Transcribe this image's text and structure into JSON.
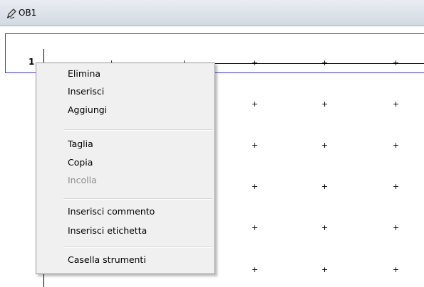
{
  "window": {
    "title": "OB1",
    "icon": "pencil-icon"
  },
  "network": {
    "number": "1"
  },
  "grid": {
    "marker": "+"
  },
  "menu": {
    "items": [
      {
        "label": "Elimina",
        "enabled": true
      },
      {
        "label": "Inserisci",
        "enabled": true
      },
      {
        "label": "Aggiungi",
        "enabled": true
      },
      {
        "label": "Taglia",
        "enabled": true
      },
      {
        "label": "Copia",
        "enabled": true
      },
      {
        "label": "Incolla",
        "enabled": false
      },
      {
        "label": "Inserisci commento",
        "enabled": true
      },
      {
        "label": "Inserisci etichetta",
        "enabled": true
      },
      {
        "label": "Casella strumenti",
        "enabled": true
      }
    ]
  },
  "colors": {
    "selection_border": "#3b3bd6",
    "menu_bg": "#f0f0f0",
    "disabled_text": "#8d8d8d"
  }
}
